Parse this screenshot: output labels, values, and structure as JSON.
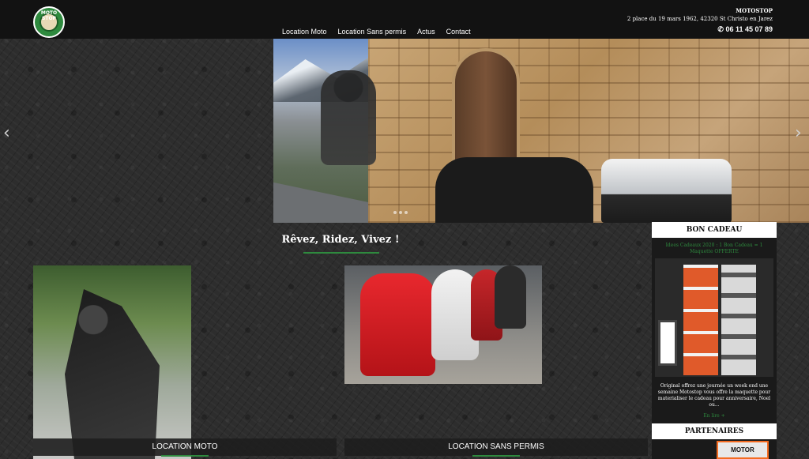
{
  "header": {
    "logo_text": "MOTO STOP",
    "nav": [
      "Location Moto",
      "Location Sans permis",
      "Actus",
      "Contact"
    ],
    "contact": {
      "brand": "MOTOSTOP",
      "address": "2 place du 19 mars 1962, 42320 St Christo en Jarez",
      "phone": "06 11 45 07 89"
    }
  },
  "slider": {
    "prev_icon": "‹",
    "next_icon": "›"
  },
  "main": {
    "title": "Rêvez, Ridez, Vivez !",
    "cards": [
      {
        "label": "LOCATION MOTO"
      },
      {
        "label": "LOCATION SANS PERMIS"
      }
    ]
  },
  "sidebar": {
    "gift": {
      "heading": "BON CADEAU",
      "link": "Idees Cadeaux 2020 : 1 Bon Cadeau = 1 Maquette OFFERTE",
      "text": "Original offrez une journée un week end une semaine Motostop vous offre la maquette pour materialiser le cadeau pour anniversaire, Noel ou...",
      "more": "En lire +"
    },
    "partners": {
      "heading": "PARTENAIRES",
      "logo_text": "MOTOR"
    }
  }
}
